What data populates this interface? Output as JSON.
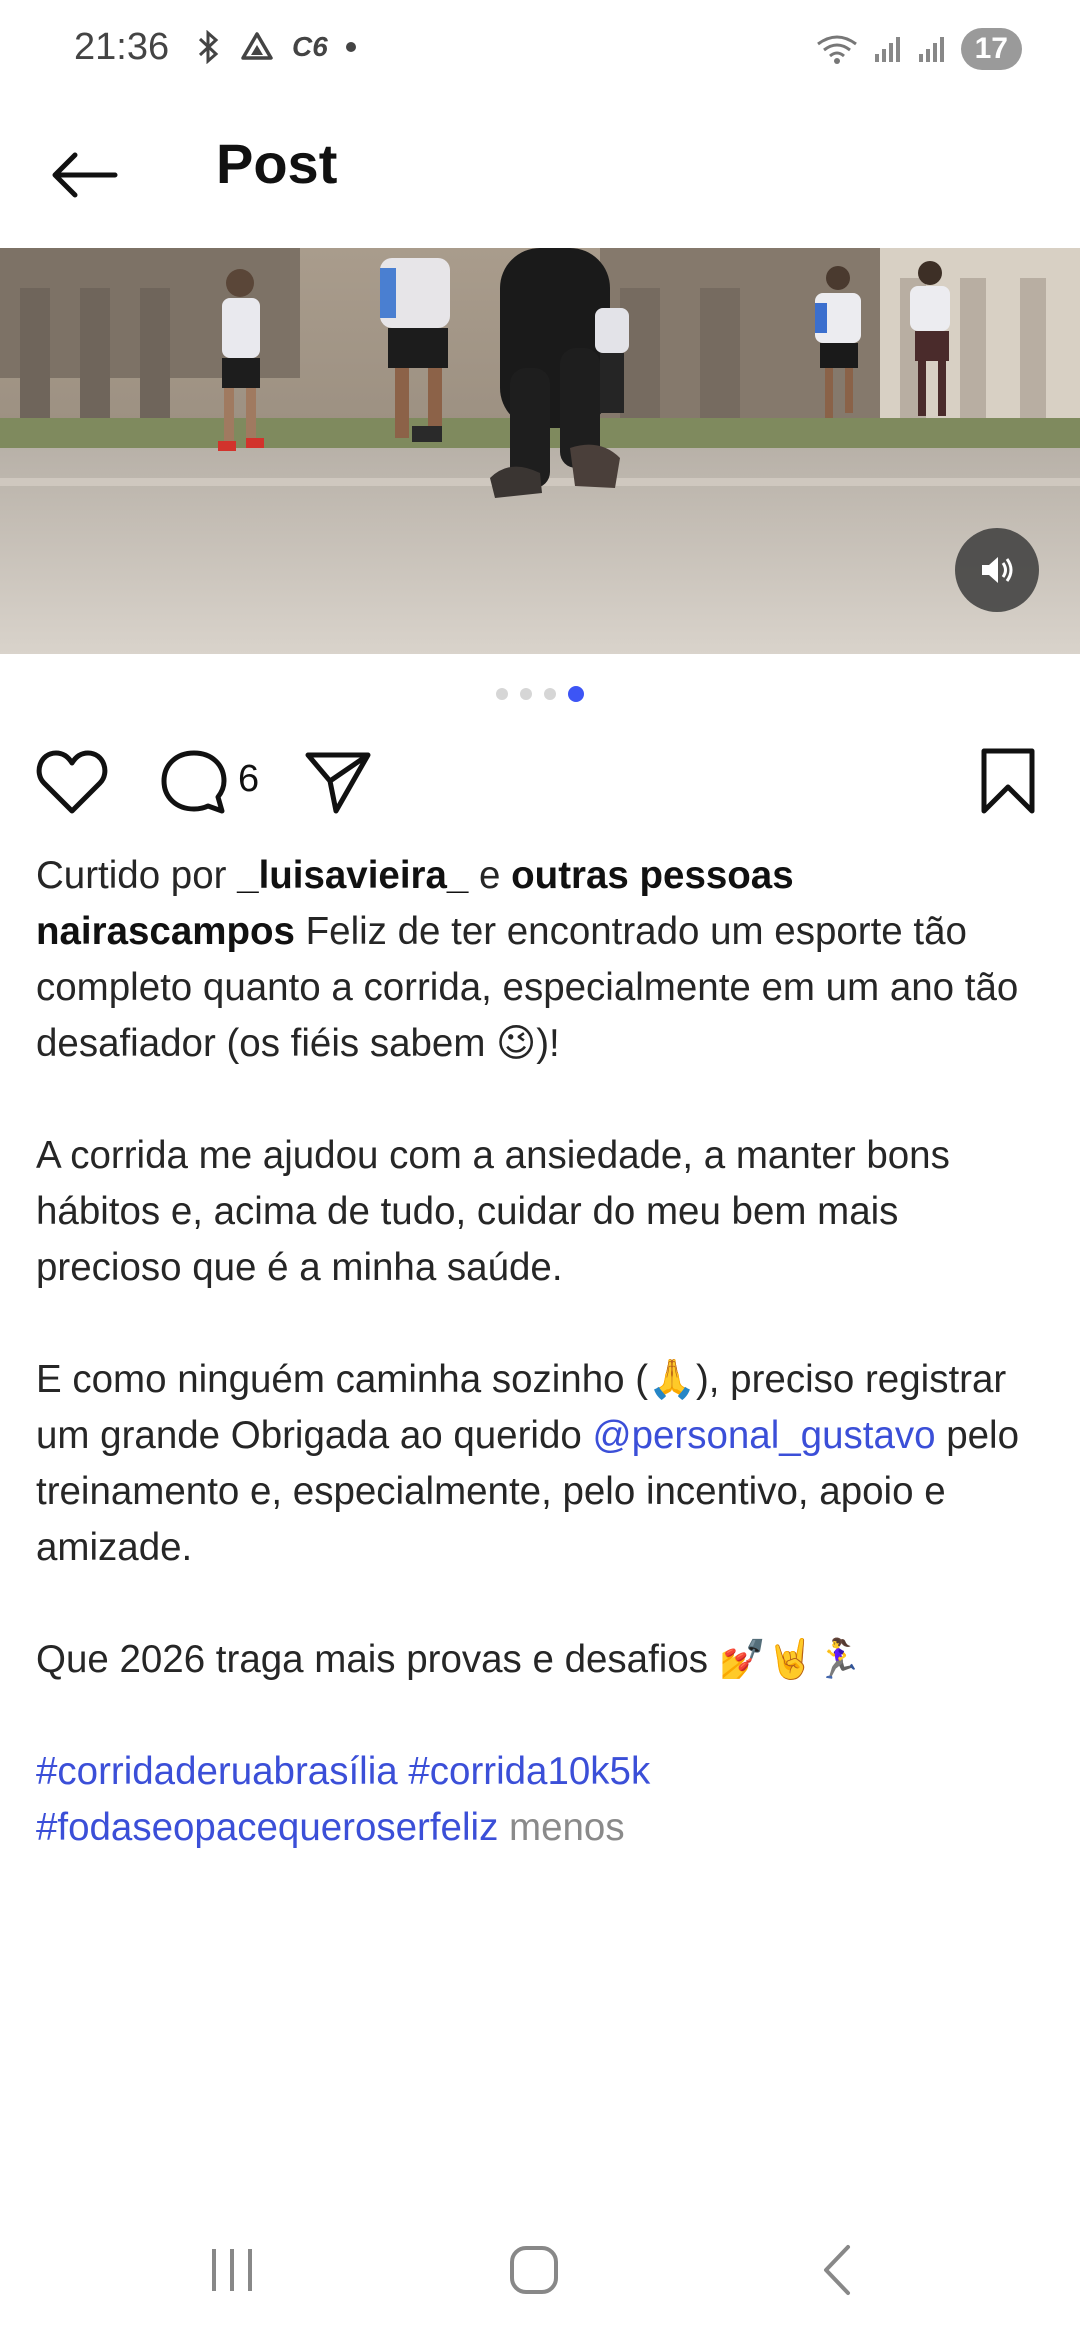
{
  "status_bar": {
    "time": "21:36",
    "carrier_badge": "C6",
    "battery": "17",
    "icons": [
      "bluetooth-icon",
      "drive-icon",
      "wifi-icon",
      "signal-icon",
      "signal-icon"
    ]
  },
  "header": {
    "title": "Post"
  },
  "media": {
    "description_icon": "running-photo",
    "carousel_total": 4,
    "carousel_active_index": 3
  },
  "actions": {
    "comment_count": "6"
  },
  "post": {
    "liked_prefix": "Curtido por",
    "liked_user": "_luisavieira_",
    "liked_conj": "e",
    "liked_others": "outras pessoas",
    "author": "nairascampos",
    "para1": "Feliz de ter encontrado um esporte tão completo quanto a corrida, especialmente em um ano tão desafiador (os fiéis sabem 😉)!",
    "para2": "A corrida me ajudou com a ansiedade,  a manter bons hábitos e, acima de tudo, cuidar do meu bem mais precioso que é a minha saúde.",
    "para3_before": "E como ninguém caminha sozinho (🙏), preciso registrar um grande Obrigada ao querido",
    "mention": "@personal_gustavo",
    "para3_after": "pelo treinamento e, especialmente,  pelo incentivo,  apoio e amizade.",
    "para4": "Que 2026  traga mais provas e desafios 💅🤘🏃‍♀️",
    "hashtag1": "#corridaderuabrasília",
    "hashtag2": "#corrida10k5k",
    "hashtag3": "#fodaseopacequeroserfeliz",
    "less_label": "menos"
  },
  "colors": {
    "link": "#3b4fd8",
    "accent_dot": "#3d55f5"
  }
}
